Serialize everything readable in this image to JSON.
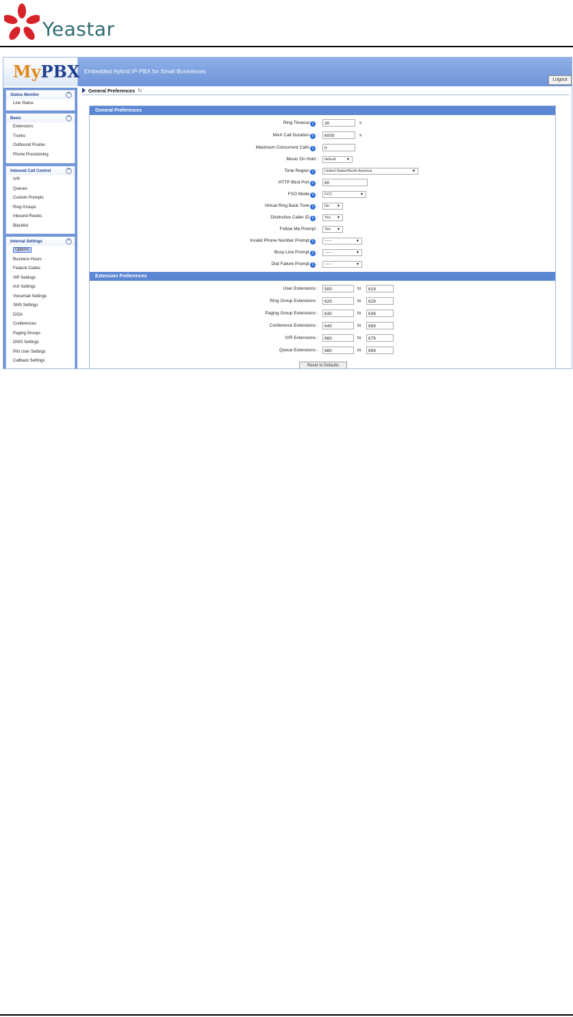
{
  "doc": {
    "logo_text": "Yeastar"
  },
  "app": {
    "brand_my": "My",
    "brand_pbx": "PBX",
    "tagline": "Embedded Hybrid IP-PBX for Small Businesses",
    "logout": "Logout"
  },
  "sidebar": {
    "groups": [
      {
        "title": "Status Monitor",
        "items": [
          "Line Status"
        ]
      },
      {
        "title": "Basic",
        "items": [
          "Extensions",
          "Trunks",
          "Outbound Routes",
          "Phone Provisioning"
        ]
      },
      {
        "title": "Inbound Call Control",
        "items": [
          "IVR",
          "Queues",
          "Custom Prompts",
          "Ring Groups",
          "Inbound Routes",
          "Blacklist"
        ]
      },
      {
        "title": "Internal Settings",
        "items": [
          "Options",
          "Business Hours",
          "Feature Codes",
          "SIP Settings",
          "IAX Settings",
          "Voicemail Settings",
          "SMS Settings",
          "DISA",
          "Conferences",
          "Paging Groups",
          "DNIS Settings",
          "PIN User Settings",
          "Callback Settings"
        ]
      }
    ]
  },
  "content": {
    "breadcrumb": "General Preferences",
    "refresh_icon": "↻",
    "general": {
      "title": "General Preferences",
      "ring_timeout": {
        "label": "Ring Timeout",
        "value": "30",
        "unit": "s"
      },
      "max_call_duration": {
        "label": "MAX Call Duration",
        "value": "6000",
        "unit": "s"
      },
      "max_concurrent_calls": {
        "label": "Maximum Concurrent Calls",
        "value": "0"
      },
      "music_on_hold": {
        "label": "Music On Hold",
        "value": "default"
      },
      "tone_region": {
        "label": "Tone Region",
        "value": "United States/North America"
      },
      "http_bind_port": {
        "label": "HTTP Bind Port",
        "value": "80"
      },
      "fxo_mode": {
        "label": "FXO Mode",
        "value": "FCC"
      },
      "virtual_ring_back_tone": {
        "label": "Virtual Ring Back Tone",
        "value": "No"
      },
      "distinctive_caller_id": {
        "label": "Distinctive Caller ID",
        "value": "Yes"
      },
      "follow_me_prompt": {
        "label": "Follow Me Prompt",
        "value": "Yes"
      },
      "invalid_phone_number_prompt": {
        "label": "Invalid Phone Number Prompt",
        "value": "------"
      },
      "busy_line_prompt": {
        "label": "Busy Line Prompt",
        "value": "------"
      },
      "dial_failure_prompt": {
        "label": "Dial Failure Prompt",
        "value": "------"
      }
    },
    "extensions": {
      "title": "Extension Preferences",
      "to_label": "to",
      "rows": [
        {
          "label": "User Extensions",
          "from": "500",
          "to": "619"
        },
        {
          "label": "Ring Group Extensions",
          "from": "620",
          "to": "629"
        },
        {
          "label": "Paging Group Extensions",
          "from": "630",
          "to": "639"
        },
        {
          "label": "Conference Extensions",
          "from": "640",
          "to": "659"
        },
        {
          "label": "IVR Extensions",
          "from": "660",
          "to": "679"
        },
        {
          "label": "Queue Extensions",
          "from": "680",
          "to": "699"
        }
      ],
      "reset_label": "Reset to Defaults"
    }
  }
}
